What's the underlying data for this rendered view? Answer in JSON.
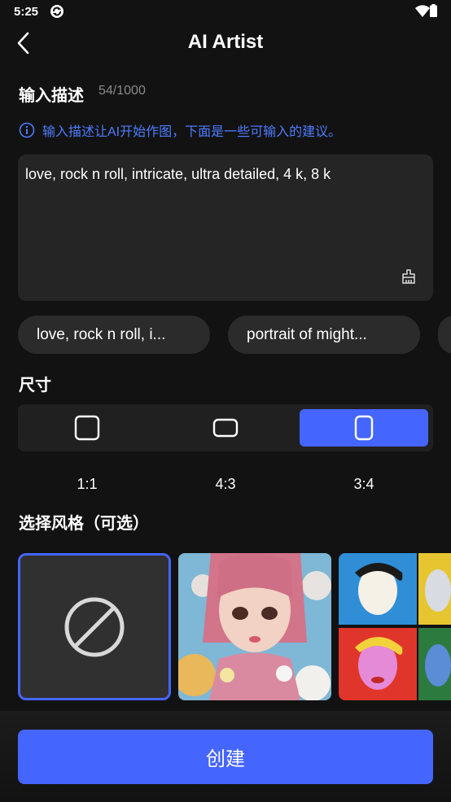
{
  "status_bar": {
    "time": "5:25",
    "icons": [
      "sync-icon",
      "wifi-icon",
      "battery-icon"
    ]
  },
  "header": {
    "title": "AI Artist",
    "back_icon": "chevron-left-icon"
  },
  "description": {
    "label": "输入描述",
    "count": "54/1000",
    "hint": "输入描述让AI开始作图，下面是一些可输入的建议。",
    "prompt": "love, rock n roll, intricate, ultra detailed, 4 k, 8 k",
    "clear_icon": "broom-icon"
  },
  "suggestions": [
    "love, rock n roll, i...",
    "portrait of might..."
  ],
  "size": {
    "label": "尺寸",
    "options": [
      {
        "label": "1:1",
        "selected": false
      },
      {
        "label": "4:3",
        "selected": false
      },
      {
        "label": "3:4",
        "selected": true
      }
    ]
  },
  "style": {
    "label": "选择风格（可选）",
    "cards": [
      {
        "kind": "none",
        "icon": "no-style-icon",
        "selected": true
      },
      {
        "kind": "anime-girl",
        "selected": false
      },
      {
        "kind": "pop-art",
        "selected": false
      }
    ]
  },
  "create_button": "创建",
  "colors": {
    "accent": "#4565ff",
    "hint": "#4d7cff",
    "background": "#121212",
    "panel": "#252525"
  }
}
